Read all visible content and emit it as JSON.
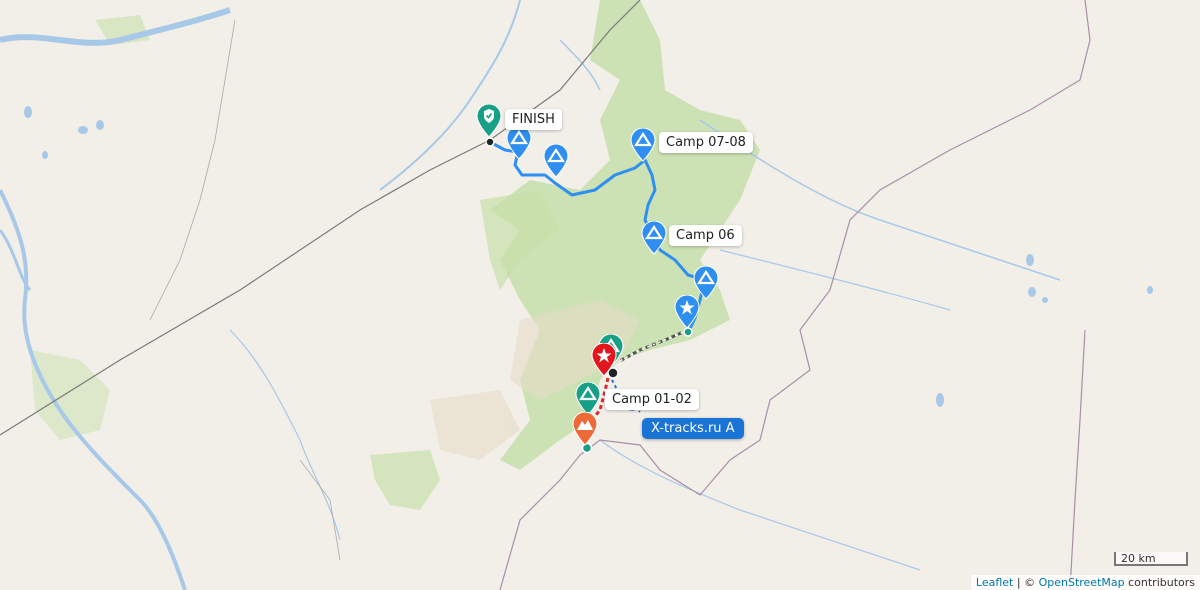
{
  "map": {
    "labels": {
      "finish": "FINISH",
      "camp_07_08": "Camp 07-08",
      "camp_06": "Camp 06",
      "camp_01_02": "Camp 01-02"
    },
    "badge": "X-tracks.ru A",
    "scale": "20 km",
    "attribution": {
      "leaflet": "Leaflet",
      "sep": " | © ",
      "osm": "OpenStreetMap",
      "suffix": " contributors"
    },
    "colors": {
      "route": "#2e8ff0",
      "route_dashed_red": "#e0262b",
      "marker_blue": "#2e8ff0",
      "marker_green": "#17a085",
      "marker_red": "#e3151e",
      "marker_orange": "#ec6a37",
      "forest": "#b9d89b",
      "water": "#a8c8e8",
      "badge": "#1a74d6"
    }
  }
}
